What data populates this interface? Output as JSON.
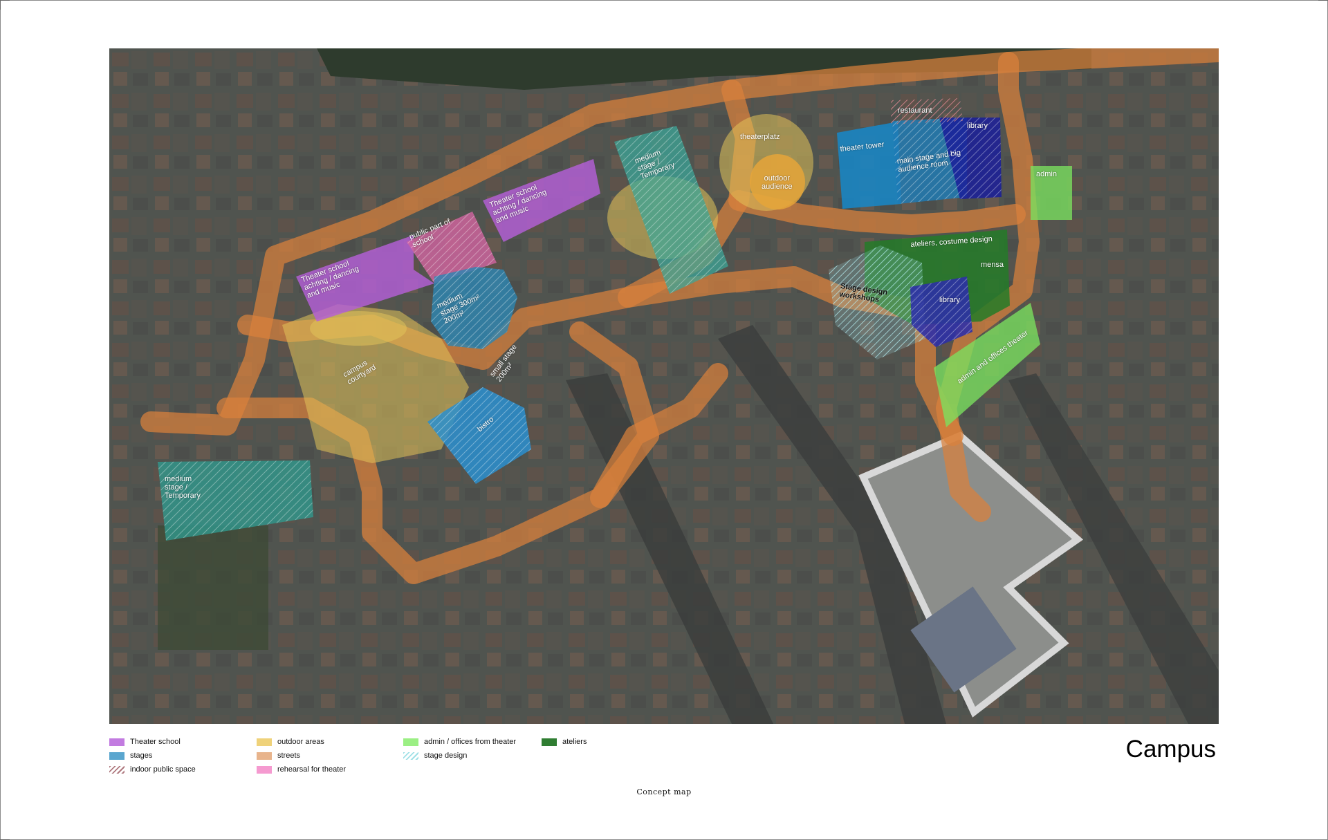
{
  "title": "Campus",
  "caption": "Concept map",
  "colors": {
    "theater_school": "#b55fd8",
    "stages": "#2f8fbd",
    "indoor_public_space": "#b07a80",
    "outdoor_areas": "#e2c35a",
    "streets": "#d9813c",
    "rehearsal": "#f28cc6",
    "admin": "#7be25f",
    "stage_design": "#bfeef0",
    "ateliers": "#2f7d32",
    "library": "#2c2fa8",
    "temporary_stage": "#3aa89a"
  },
  "legend": [
    {
      "key": "theater_school",
      "label": "Theater school",
      "color": "#c27be0",
      "pattern": "solid"
    },
    {
      "key": "stages",
      "label": "stages",
      "color": "#5aa6cf",
      "pattern": "solid"
    },
    {
      "key": "indoor_public_space",
      "label": "indoor public space",
      "color": "#b07a80",
      "pattern": "hatch"
    },
    {
      "key": "outdoor_areas",
      "label": "outdoor areas",
      "color": "#efd27a",
      "pattern": "solid"
    },
    {
      "key": "streets",
      "label": "streets",
      "color": "#e8b48c",
      "pattern": "solid"
    },
    {
      "key": "rehearsal",
      "label": "rehearsal for theater",
      "color": "#f59ad0",
      "pattern": "solid"
    },
    {
      "key": "admin",
      "label": "admin / offices from theater",
      "color": "#9bef84",
      "pattern": "solid"
    },
    {
      "key": "stage_design",
      "label": "stage design",
      "color": "#9fe0e6",
      "pattern": "hatch"
    },
    {
      "key": "ateliers",
      "label": "ateliers",
      "color": "#2f7d32",
      "pattern": "solid"
    }
  ],
  "labels": {
    "theater_school_1": "Theater school\nachting / dancing\nand music",
    "public_part": "public part of\nschool",
    "theater_school_2": "Theater school\nachting / dancing\nand music",
    "medium_stage_top": "medium\nstage /\nTemporary",
    "theaterplatz": "theaterplatz",
    "outdoor_audience": "outdoor\naudience",
    "restaurant": "restaurant",
    "theater_tower": "theater tower",
    "main_stage": "main stage and big\naudience room",
    "library_top": "library",
    "admin_top": "admin",
    "ateliers": "ateliers, costume design",
    "mensa": "mensa",
    "stage_design": "Stage design\nworkshops",
    "library_mid": "library",
    "admin_offices": "admin and offices theater",
    "medium_stage_300": "medium\nstage 300m²\n200m²",
    "campus_courtyard": "campus\ncourtyard",
    "small_stage": "small stage\n200m²",
    "bistro": "bistro",
    "medium_stage_bottom": "medium\nstage /\nTemporary"
  }
}
